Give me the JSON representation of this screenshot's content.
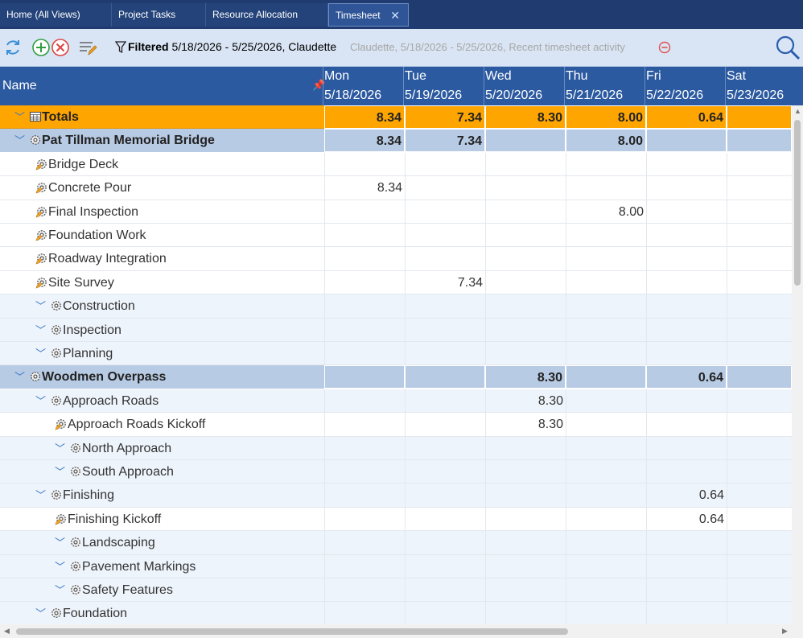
{
  "tabs": [
    {
      "label": "Home (All Views)"
    },
    {
      "label": "Project Tasks"
    },
    {
      "label": "Resource Allocation"
    },
    {
      "label": "Timesheet",
      "active": true
    }
  ],
  "toolbar": {
    "icons": [
      "refresh-icon",
      "add-icon",
      "delete-icon",
      "edit-list-icon",
      "filter-icon",
      "remove-filter-icon",
      "search-icon"
    ],
    "filter_bold": "Filtered",
    "filter_text": "5/18/2026 - 5/25/2026, Claudette",
    "filter_ghost": "Claudette, 5/18/2026 - 5/25/2026, Recent timesheet activity"
  },
  "grid": {
    "name_header": "Name",
    "days": [
      {
        "day": "Mon",
        "date": "5/18/2026"
      },
      {
        "day": "Tue",
        "date": "5/19/2026"
      },
      {
        "day": "Wed",
        "date": "5/20/2026"
      },
      {
        "day": "Thu",
        "date": "5/21/2026"
      },
      {
        "day": "Fri",
        "date": "5/22/2026"
      },
      {
        "day": "Sat",
        "date": "5/23/2026"
      }
    ],
    "rows": [
      {
        "type": "totals",
        "indent": 0,
        "expand": true,
        "name": "Totals",
        "values": [
          "8.34",
          "7.34",
          "8.30",
          "8.00",
          "0.64",
          ""
        ]
      },
      {
        "type": "project",
        "indent": 0,
        "expand": true,
        "name": "Pat Tillman Memorial Bridge",
        "values": [
          "8.34",
          "7.34",
          "",
          "8.00",
          "",
          ""
        ]
      },
      {
        "type": "task",
        "indent": 1,
        "expand": false,
        "name": "Bridge Deck",
        "values": [
          "",
          "",
          "",
          "",
          "",
          ""
        ]
      },
      {
        "type": "task",
        "indent": 1,
        "expand": false,
        "name": "Concrete Pour",
        "values": [
          "8.34",
          "",
          "",
          "",
          "",
          ""
        ]
      },
      {
        "type": "task",
        "indent": 1,
        "expand": false,
        "name": "Final Inspection",
        "values": [
          "",
          "",
          "",
          "8.00",
          "",
          ""
        ]
      },
      {
        "type": "task",
        "indent": 1,
        "expand": false,
        "name": "Foundation Work",
        "values": [
          "",
          "",
          "",
          "",
          "",
          ""
        ]
      },
      {
        "type": "task",
        "indent": 1,
        "expand": false,
        "name": "Roadway Integration",
        "values": [
          "",
          "",
          "",
          "",
          "",
          ""
        ]
      },
      {
        "type": "task",
        "indent": 1,
        "expand": false,
        "name": "Site Survey",
        "values": [
          "",
          "7.34",
          "",
          "",
          "",
          ""
        ]
      },
      {
        "type": "group",
        "indent": 1,
        "expand": true,
        "name": "Construction",
        "values": [
          "",
          "",
          "",
          "",
          "",
          ""
        ]
      },
      {
        "type": "group",
        "indent": 1,
        "expand": true,
        "name": "Inspection",
        "values": [
          "",
          "",
          "",
          "",
          "",
          ""
        ]
      },
      {
        "type": "group",
        "indent": 1,
        "expand": true,
        "name": "Planning",
        "values": [
          "",
          "",
          "",
          "",
          "",
          ""
        ]
      },
      {
        "type": "project",
        "indent": 0,
        "expand": true,
        "name": "Woodmen Overpass",
        "values": [
          "",
          "",
          "8.30",
          "",
          "0.64",
          ""
        ]
      },
      {
        "type": "group",
        "indent": 1,
        "expand": true,
        "name": "Approach Roads",
        "values": [
          "",
          "",
          "8.30",
          "",
          "",
          ""
        ]
      },
      {
        "type": "task",
        "indent": 2,
        "expand": false,
        "name": "Approach Roads Kickoff",
        "values": [
          "",
          "",
          "8.30",
          "",
          "",
          ""
        ]
      },
      {
        "type": "group",
        "indent": 2,
        "expand": true,
        "name": "North Approach",
        "values": [
          "",
          "",
          "",
          "",
          "",
          ""
        ]
      },
      {
        "type": "group",
        "indent": 2,
        "expand": true,
        "name": "South Approach",
        "values": [
          "",
          "",
          "",
          "",
          "",
          ""
        ]
      },
      {
        "type": "group",
        "indent": 1,
        "expand": true,
        "name": "Finishing",
        "values": [
          "",
          "",
          "",
          "",
          "0.64",
          ""
        ]
      },
      {
        "type": "task",
        "indent": 2,
        "expand": false,
        "name": "Finishing Kickoff",
        "values": [
          "",
          "",
          "",
          "",
          "0.64",
          ""
        ]
      },
      {
        "type": "group",
        "indent": 2,
        "expand": true,
        "name": "Landscaping",
        "values": [
          "",
          "",
          "",
          "",
          "",
          ""
        ]
      },
      {
        "type": "group",
        "indent": 2,
        "expand": true,
        "name": "Pavement Markings",
        "values": [
          "",
          "",
          "",
          "",
          "",
          ""
        ]
      },
      {
        "type": "group",
        "indent": 2,
        "expand": true,
        "name": "Safety Features",
        "values": [
          "",
          "",
          "",
          "",
          "",
          ""
        ]
      },
      {
        "type": "group",
        "indent": 1,
        "expand": true,
        "name": "Foundation",
        "values": [
          "",
          "",
          "",
          "",
          "",
          ""
        ]
      }
    ]
  },
  "colors": {
    "accent": "#2c5aa0",
    "tabbar": "#1f3b6f",
    "totals": "#ffa500",
    "project_row": "#b8cbe4",
    "group_row": "#eef4fb"
  }
}
